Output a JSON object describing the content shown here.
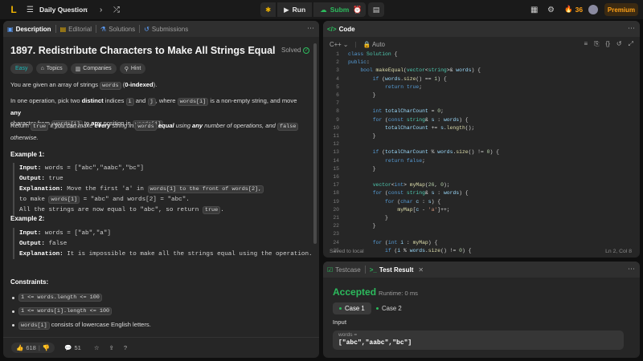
{
  "topbar": {
    "logo_glyph": "L",
    "title": "Daily Question",
    "run_label": "Run",
    "submit_label": "Submit",
    "streak": "36",
    "premium_label": "Premium"
  },
  "left_tabs": [
    {
      "label": "Description"
    },
    {
      "label": "Editorial"
    },
    {
      "label": "Solutions"
    },
    {
      "label": "Submissions"
    }
  ],
  "problem": {
    "title": "1897. Redistribute Characters to Make All Strings Equal",
    "status": "Solved",
    "chips": [
      "Easy",
      "Topics",
      "Companies",
      "Hint"
    ],
    "p1": [
      "You are given an array of strings ",
      "words",
      " (",
      "0-indexed",
      ")."
    ],
    "p2a": [
      "In one operation, pick two ",
      "distinct",
      " indices ",
      "i",
      " and ",
      "j",
      ", where ",
      "words[i]",
      " is a non-empty string, and move ",
      "any"
    ],
    "p2b": [
      "character from ",
      "words[i]",
      " to ",
      "any",
      " position in ",
      "words[j]",
      "."
    ],
    "p3": [
      "Return ",
      "true",
      " if you can make ",
      "every",
      " string in ",
      "words",
      " equal",
      " using ",
      "any",
      " number of operations, and ",
      "false",
      " otherwise."
    ],
    "ex1_title": "Example 1:",
    "ex1": {
      "input_k": "Input:",
      "input_v": " words = [\"abc\",\"aabc\",\"bc\"]",
      "output_k": "Output:",
      "output_v": " true",
      "expl_k": "Explanation:",
      "expl_v1": " Move the first 'a' in ",
      "expl_c1": "words[1] to the front of words[2],",
      "expl_l2a": "to make ",
      "expl_c2": "words[1]",
      "expl_l2b": " = \"abc\" and words[2] = \"abc\".",
      "expl_l3a": "All the strings are now equal to \"abc\", so return ",
      "expl_c3": "true",
      "expl_l3b": "."
    },
    "ex2_title": "Example 2:",
    "ex2": {
      "input_k": "Input:",
      "input_v": " words = [\"ab\",\"a\"]",
      "output_k": "Output:",
      "output_v": " false",
      "expl_k": "Explanation:",
      "expl_v": " It is impossible to make all the strings equal using the operation."
    },
    "constraints_title": "Constraints:",
    "constraints": [
      {
        "code": "1 <= words.length <= 100",
        "text": ""
      },
      {
        "code": "1 <= words[i].length <= 100",
        "text": ""
      },
      {
        "code": "words[i]",
        "text": " consists of lowercase English letters."
      }
    ]
  },
  "desc_footer": {
    "likes": "618",
    "comments": "51"
  },
  "code_panel": {
    "title": "Code",
    "language": "C++",
    "mode": "Auto",
    "status": "Saved to local",
    "position": "Ln 2, Col 8"
  },
  "code_lines": [
    "class Solution {",
    "public:",
    "    bool makeEqual(vector<string>& words) {",
    "        if (words.size() == 1) {",
    "            return true;",
    "        }",
    "",
    "        int totalCharCount = 0;",
    "        for (const string& s : words) {",
    "            totalCharCount += s.length();",
    "        }",
    "",
    "        if (totalCharCount % words.size() != 0) {",
    "            return false;",
    "        }",
    "",
    "        vector<int> myMap(26, 0);",
    "        for (const string& s : words) {",
    "            for (char c : s) {",
    "                myMap[c - 'a']++;",
    "            }",
    "        }",
    "",
    "        for (int i : myMap) {",
    "            if (i % words.size() != 0) {"
  ],
  "test_panel": {
    "tab_testcase": "Testcase",
    "tab_result": "Test Result",
    "verdict": "Accepted",
    "runtime": "Runtime: 0 ms",
    "cases": [
      "Case 1",
      "Case 2"
    ],
    "input_label": "Input",
    "var_label": "words =",
    "var_value": "[\"abc\",\"aabc\",\"bc\"]"
  },
  "colors": {
    "accent_green": "#2cbb5d",
    "accent_orange": "#ffa116",
    "easy_teal": "#1cb8b8"
  }
}
